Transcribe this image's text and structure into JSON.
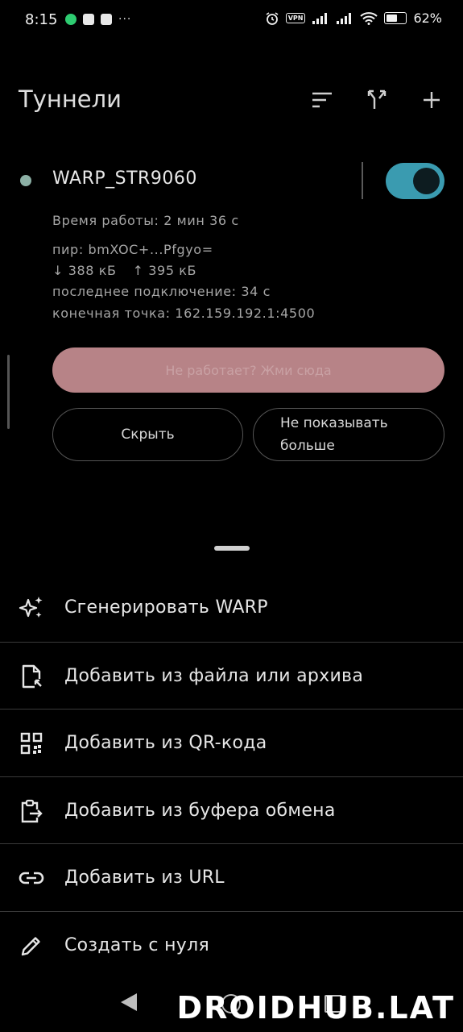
{
  "status_bar": {
    "time": "8:15",
    "more": "···",
    "vpn": "VPN",
    "battery": "62%",
    "battery_level_percent": 62
  },
  "app_bar": {
    "title": "Туннели"
  },
  "tunnel": {
    "name": "WARP_STR9060",
    "status_color": "#8cb0a5",
    "enabled": true,
    "uptime": "Время работы: 2 мин 36 с",
    "peer": "пир: bmXOC+...Pfgyo=",
    "rx": "↓ 388 кБ",
    "tx": "↑ 395 кБ",
    "last_handshake": "последнее подключение: 34 с",
    "endpoint": "конечная точка: 162.159.192.1:4500"
  },
  "banner": {
    "button": "Не работает? Жми сюда",
    "hide": "Скрыть",
    "dont_show": "Не показывать больше"
  },
  "sheet": {
    "items": [
      {
        "label": "Сгенерировать WARP",
        "icon": "sparkle-icon"
      },
      {
        "label": "Добавить из файла или архива",
        "icon": "file-import-icon"
      },
      {
        "label": "Добавить из QR-кода",
        "icon": "qr-code-icon"
      },
      {
        "label": "Добавить из буфера обмена",
        "icon": "clipboard-icon"
      },
      {
        "label": "Добавить из URL",
        "icon": "link-icon"
      },
      {
        "label": "Создать с нуля",
        "icon": "pencil-icon"
      }
    ]
  },
  "watermark": "DROIDHUB.LAT",
  "colors": {
    "accent": "#3a9bb0",
    "banner": "#b78387",
    "background": "#000000"
  }
}
